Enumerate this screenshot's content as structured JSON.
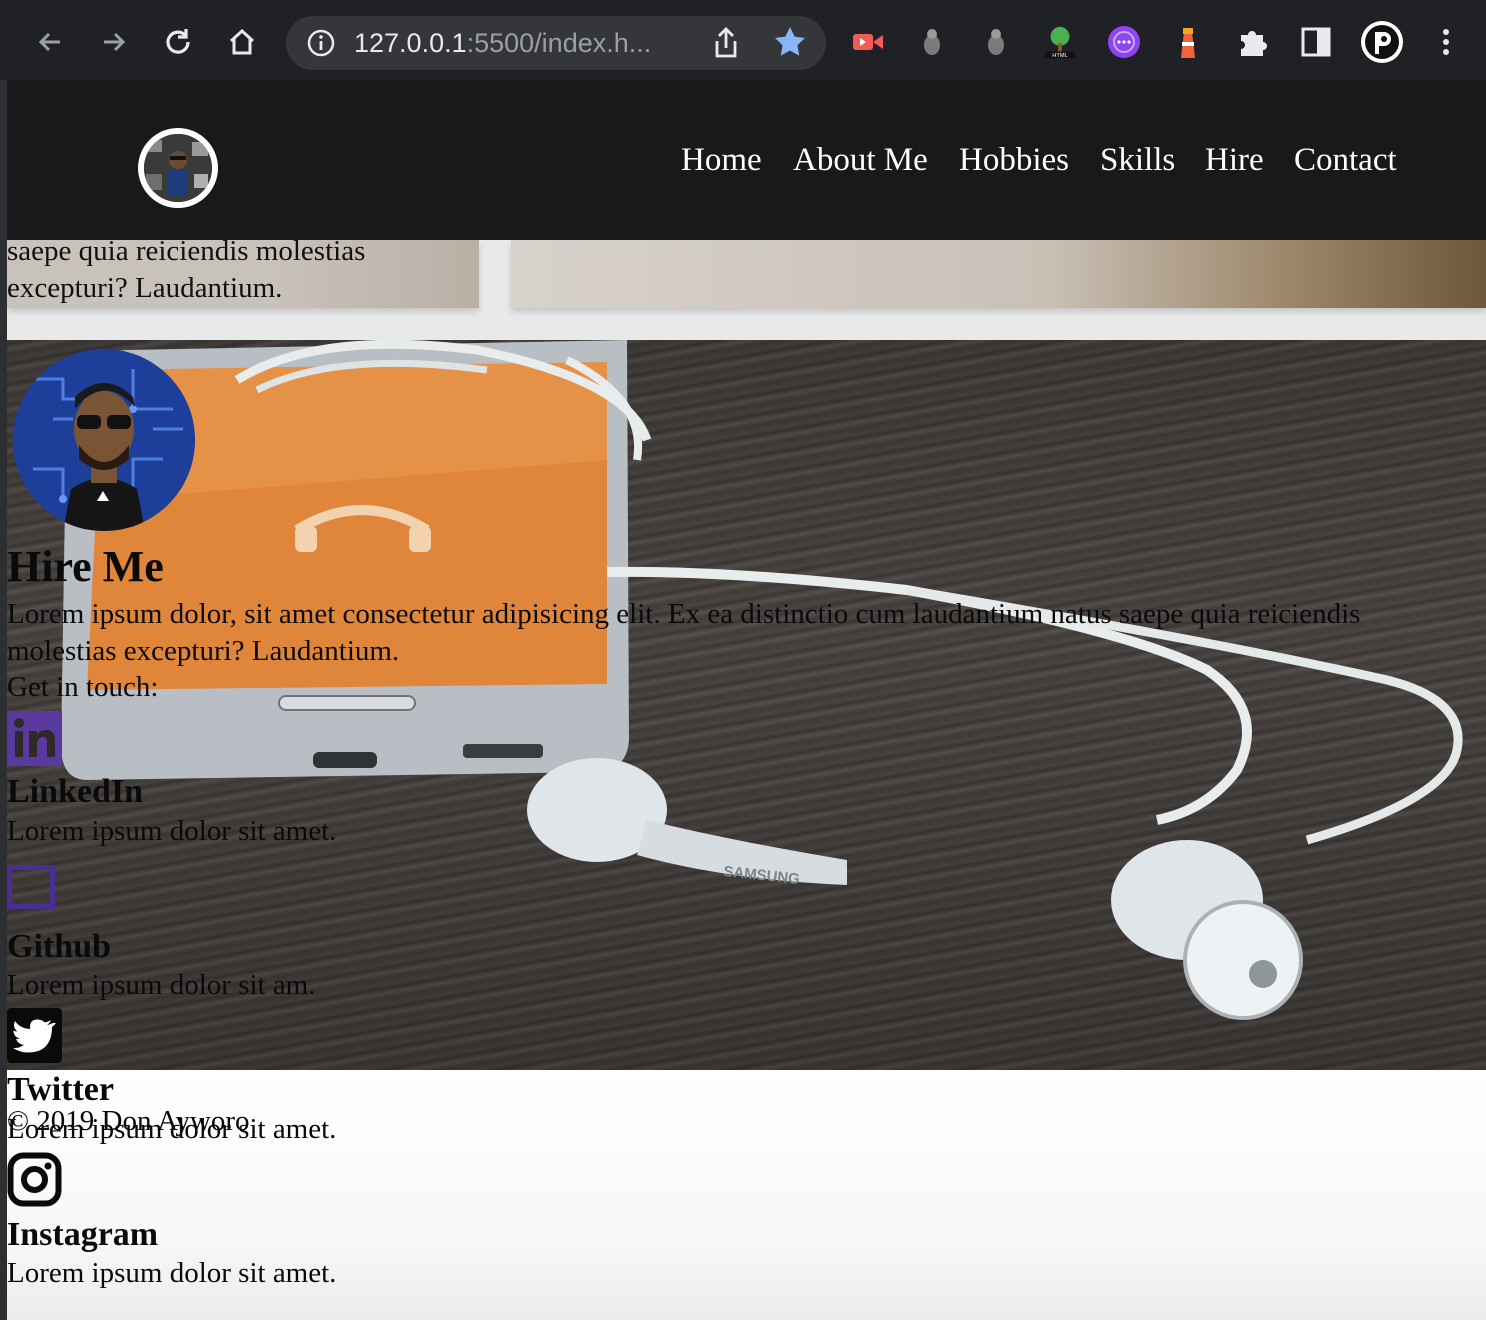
{
  "browser": {
    "url_host": "127.0.0.1",
    "url_rest": ":5500/index.h...",
    "icons": [
      "back-icon",
      "forward-icon",
      "reload-icon",
      "home-icon",
      "site-info-icon",
      "share-icon",
      "bookmark-star-icon",
      "extension-icons",
      "puzzle-icon",
      "side-panel-icon",
      "profile-avatar",
      "menu-kebab-icon"
    ],
    "accent": "#8ab4f8"
  },
  "header": {
    "nav": [
      "Home",
      "About Me",
      "Hobbies",
      "Skills",
      "Hire",
      "Contact"
    ]
  },
  "previous_section": {
    "text": "saepe quia reiciendis molestias excepturi? Laudantium."
  },
  "hire": {
    "title": "Hire Me",
    "description": "Lorem ipsum dolor, sit amet consectetur adipisicing elit. Ex ea distinctio cum laudantium natus saepe quia reiciendis molestias excepturi? Laudantium.",
    "get_in_touch": "Get in touch:",
    "socials": [
      {
        "title": "LinkedIn",
        "desc": "Lorem ipsum dolor sit amet.",
        "icon": "linkedin-icon"
      },
      {
        "title": "Github",
        "desc": "Lorem ipsum dolor sit am.",
        "icon": "github-icon"
      },
      {
        "title": "Twitter",
        "desc": "Lorem ipsum dolor sit amet.",
        "icon": "twitter-icon"
      },
      {
        "title": "Instagram",
        "desc": "Lorem ipsum dolor sit amet.",
        "icon": "instagram-icon"
      }
    ],
    "colors": {
      "linkedin": "#5b3aa0",
      "github": "#4b2e91"
    }
  },
  "footer": {
    "copyright": "© 2019 Don Ayworo"
  }
}
